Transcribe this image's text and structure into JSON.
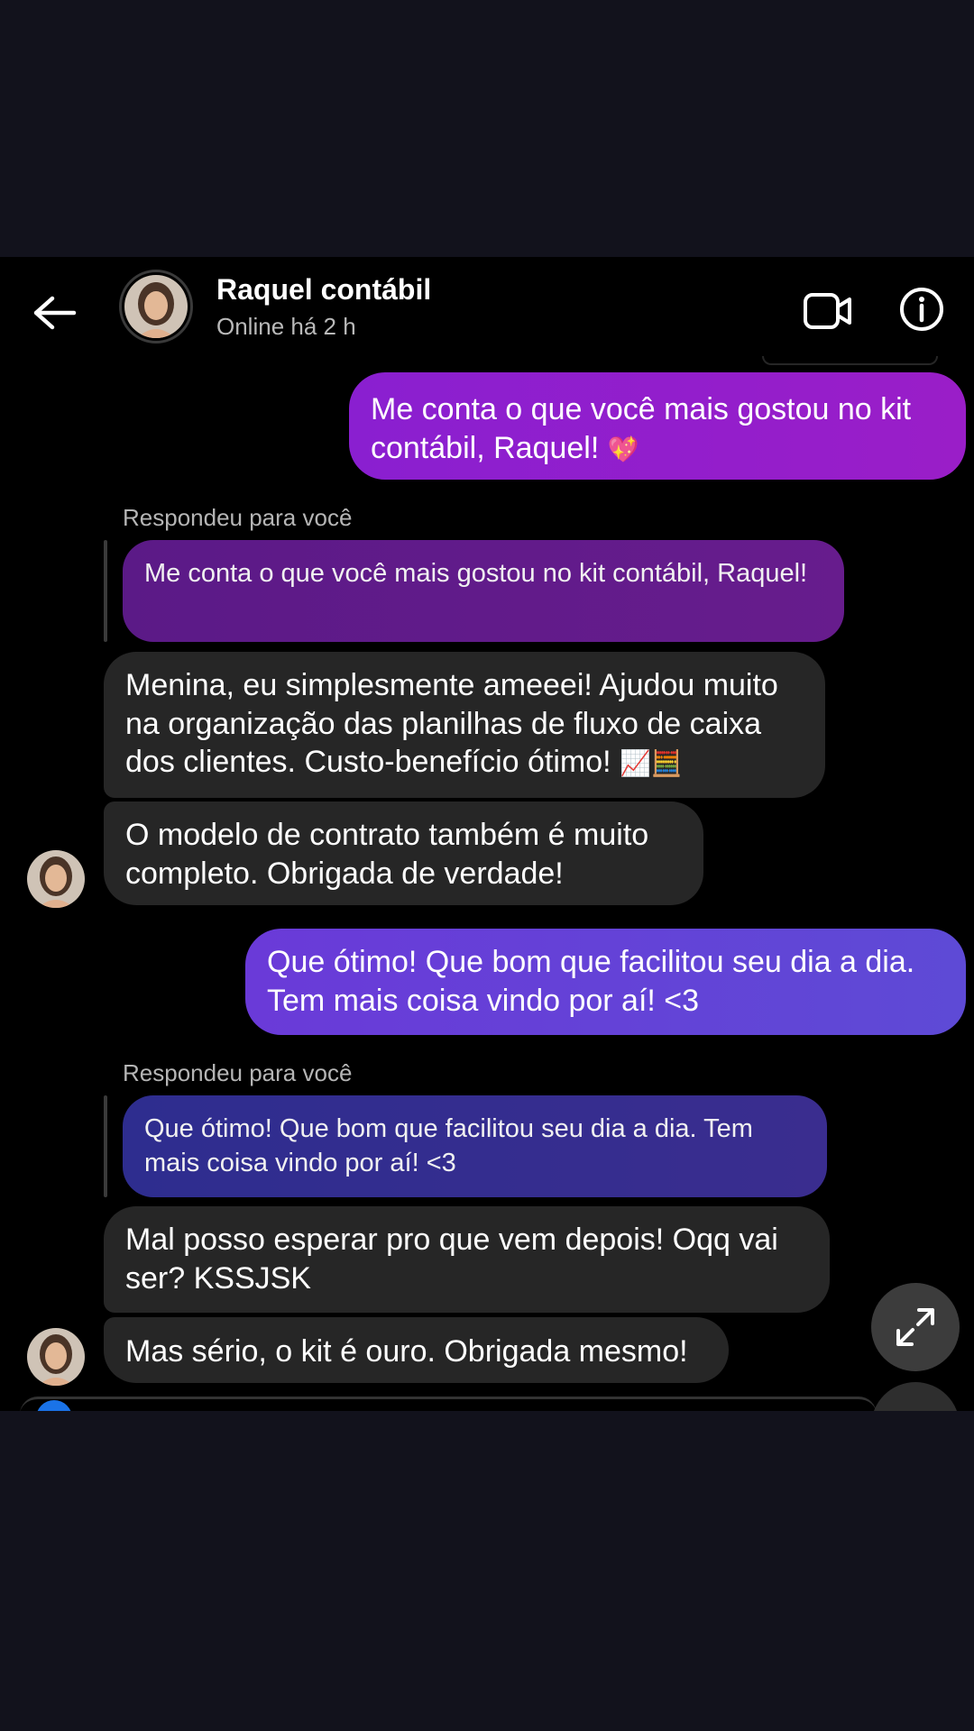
{
  "header": {
    "contact_name": "Raquel contábil",
    "status": "Online há 2 h",
    "back_icon": "arrow-left-icon",
    "video_icon": "video-camera-icon",
    "info_icon": "info-icon"
  },
  "messages": [
    {
      "direction": "outgoing",
      "text": "Me conta o que você mais gostou no kit contábil, Raquel!",
      "emoji": "💖"
    },
    {
      "direction": "incoming",
      "reply_label": "Respondeu para você",
      "quoted_text": "Me conta o que você mais gostou no kit contábil, Raquel!"
    },
    {
      "direction": "incoming",
      "text": "Menina, eu simplesmente ameeei! Ajudou muito na organização das planilhas de fluxo de caixa dos clientes. Custo-benefício ótimo!",
      "emoji": "📈🧮"
    },
    {
      "direction": "incoming",
      "text": "O modelo de contrato também é muito completo. Obrigada de verdade!"
    },
    {
      "direction": "outgoing",
      "text": "Que ótimo! Que bom que facilitou seu dia a dia. Tem mais coisa vindo por aí! <3"
    },
    {
      "direction": "incoming",
      "reply_label": "Respondeu para você",
      "quoted_text": "Que ótimo! Que bom que facilitou seu dia a dia. Tem mais coisa vindo por aí! <3"
    },
    {
      "direction": "incoming",
      "text": "Mal posso esperar pro que vem depois! Oqq vai ser? KSSJSK"
    },
    {
      "direction": "incoming",
      "text": "Mas sério, o kit é ouro. Obrigada mesmo!"
    }
  ],
  "colors": {
    "outgoing_purple": "#9a1ec8",
    "outgoing_indigo": "#5e4ad6",
    "quote_purple": "#5b1a87",
    "quote_indigo": "#2e2d8f",
    "incoming_bubble": "#262626"
  },
  "floating": {
    "expand_icon": "expand-arrows-icon"
  }
}
